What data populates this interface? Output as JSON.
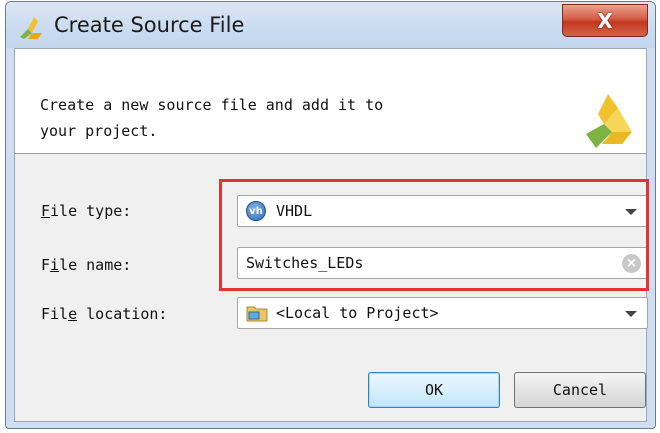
{
  "window": {
    "title": "Create Source File",
    "close_label": "X"
  },
  "header": {
    "description_line1": "Create a new source file and add it to",
    "description_line2": "your project."
  },
  "form": {
    "file_type": {
      "label_prefix": "",
      "label_mnemonic": "F",
      "label_rest": "ile type:",
      "value": "VHDL",
      "icon": "vh"
    },
    "file_name": {
      "label_prefix": "F",
      "label_mnemonic": "i",
      "label_rest": "le name:",
      "value": "Switches_LEDs",
      "clear": "×"
    },
    "file_location": {
      "label_prefix": "Fil",
      "label_mnemonic": "e",
      "label_rest": " location:",
      "value": "<Local to Project>"
    }
  },
  "buttons": {
    "ok": "OK",
    "cancel": "Cancel"
  },
  "colors": {
    "highlight": "#e3342f",
    "logo_yellow": "#f2c12e",
    "logo_green": "#7cb342"
  }
}
